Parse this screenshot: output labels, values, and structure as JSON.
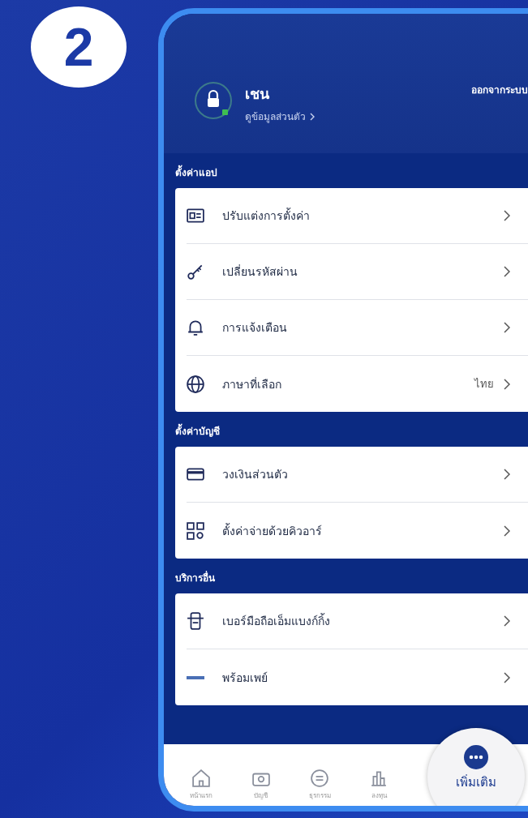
{
  "step": "2",
  "profile": {
    "name": "เชน",
    "link": "ดูข้อมูลส่วนตัว",
    "logout": "ออกจากระบบ"
  },
  "sections": [
    {
      "title": "ตั้งค่าแอป",
      "items": [
        {
          "label": "ปรับแต่งการตั้งค่า"
        },
        {
          "label": "เปลี่ยนรหัสผ่าน"
        },
        {
          "label": "การแจ้งเตือน"
        },
        {
          "label": "ภาษาที่เลือก",
          "value": "ไทย"
        }
      ]
    },
    {
      "title": "ตั้งค่าบัญชี",
      "items": [
        {
          "label": "วงเงินส่วนตัว"
        },
        {
          "label": "ตั้งค่าจ่ายด้วยคิวอาร์"
        }
      ]
    },
    {
      "title": "บริการอื่น",
      "items": [
        {
          "label": "เบอร์มือถือเอ็มแบงก์กิ้ง"
        },
        {
          "label": "พร้อมเพย์"
        }
      ]
    }
  ],
  "nav": [
    {
      "label": "หน้าแรก",
      "selected": false
    },
    {
      "label": "บัญชี",
      "selected": false
    },
    {
      "label": "ธุรกรรม",
      "selected": false
    },
    {
      "label": "ลงทุน",
      "selected": false
    },
    {
      "label": "เพิ่มเติม",
      "selected": true
    }
  ]
}
